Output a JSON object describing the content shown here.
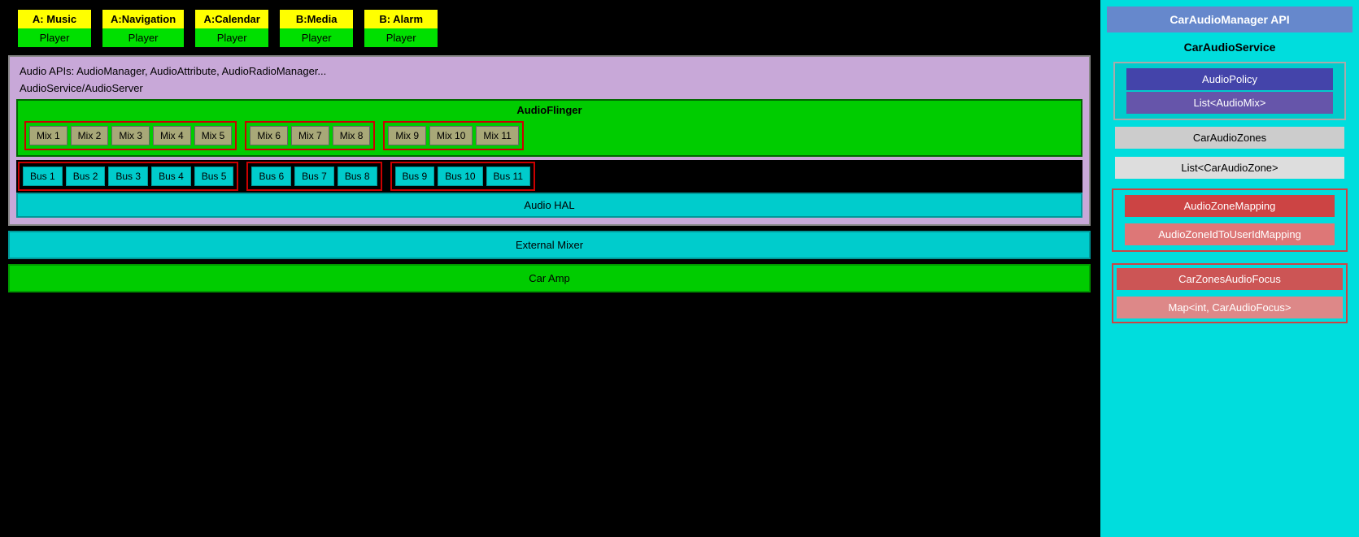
{
  "app_players": [
    {
      "label": "A: Music",
      "player": "Player"
    },
    {
      "label": "A:Navigation",
      "player": "Player"
    },
    {
      "label": "A:Calendar",
      "player": "Player"
    },
    {
      "label": "B:Media",
      "player": "Player"
    },
    {
      "label": "B: Alarm",
      "player": "Player"
    }
  ],
  "arch": {
    "audio_apis": "Audio APIs: AudioManager, AudioAttribute, AudioRadioManager...",
    "audio_service": "AudioService/AudioServer",
    "audio_flinger": "AudioFlinger",
    "audio_hal": "Audio HAL",
    "external_mixer": "External Mixer",
    "car_amp": "Car Amp"
  },
  "mix_zones": [
    {
      "mixes": [
        "Mix 1",
        "Mix 2",
        "Mix 3",
        "Mix 4",
        "Mix 5"
      ]
    },
    {
      "mixes": [
        "Mix 6",
        "Mix 7",
        "Mix 8"
      ]
    },
    {
      "mixes": [
        "Mix 9",
        "Mix 10",
        "Mix 11"
      ]
    }
  ],
  "bus_zones": [
    {
      "buses": [
        "Bus 1",
        "Bus 2",
        "Bus 3",
        "Bus 4",
        "Bus 5"
      ]
    },
    {
      "buses": [
        "Bus 6",
        "Bus 7",
        "Bus 8"
      ]
    },
    {
      "buses": [
        "Bus 9",
        "Bus 10",
        "Bus 11"
      ]
    }
  ],
  "right_panel": {
    "car_audio_manager_api": "CarAudioManager API",
    "car_audio_service": "CarAudioService",
    "audio_policy": "AudioPolicy",
    "list_audio_mix": "List<AudioMix>",
    "car_audio_zones": "CarAudioZones",
    "list_car_audio_zone": "List<CarAudioZone>",
    "audio_zone_mapping": "AudioZoneMapping",
    "audio_zone_id_to_user_id_mapping": "AudioZoneIdToUserIdMapping",
    "car_zones_audio_focus": "CarZonesAudioFocus",
    "map_car_audio_focus": "Map<int, CarAudioFocus>"
  }
}
